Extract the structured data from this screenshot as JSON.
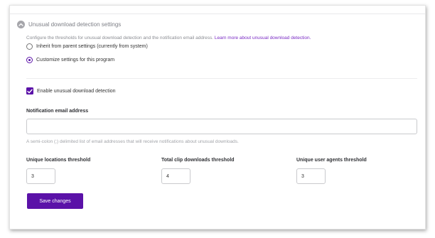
{
  "section": {
    "title": "Unusual download detection settings",
    "description": "Configure the thresholds for unusual download detection and the notification email address.",
    "learn_more_link": "Learn more about unusual download detection."
  },
  "settings_source": {
    "options": [
      {
        "label": "Inherit from parent settings (currently from system)",
        "selected": false
      },
      {
        "label": "Customize settings for this program",
        "selected": true
      }
    ]
  },
  "enable_detection": {
    "label": "Enable unusual download detection",
    "checked": true
  },
  "notification_email": {
    "label": "Notification email address",
    "value": "",
    "hint": "A semi-colon (;) delimited list of email addresses that will receive notifications about unusual downloads."
  },
  "thresholds": [
    {
      "label": "Unique locations threshold",
      "value": "3"
    },
    {
      "label": "Total clip downloads threshold",
      "value": "4"
    },
    {
      "label": "Unique user agents threshold",
      "value": "3"
    }
  ],
  "actions": {
    "save_label": "Save changes"
  },
  "colors": {
    "accent": "#5b12a8",
    "link": "#7a2bc4"
  }
}
